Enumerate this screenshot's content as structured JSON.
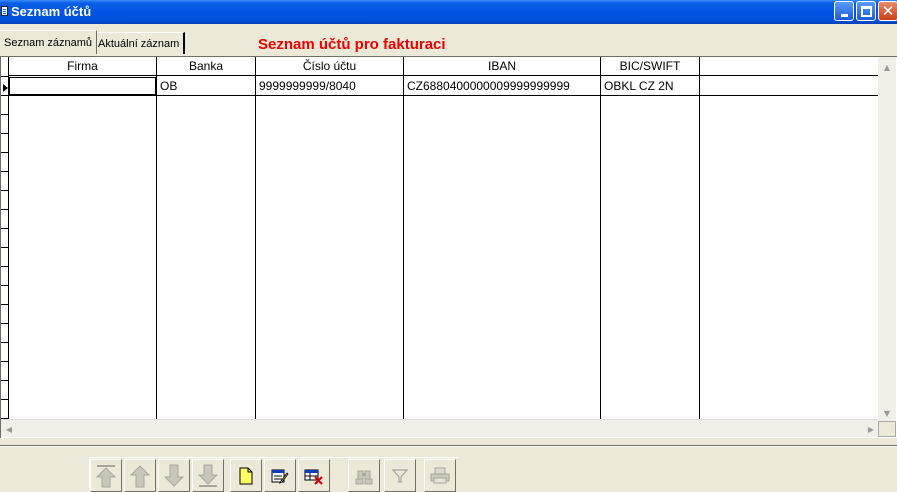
{
  "window": {
    "title": "Seznam účtů"
  },
  "tabs": [
    {
      "label": "Seznam záznamů",
      "active": true
    },
    {
      "label": "Aktuální záznam",
      "active": false
    }
  ],
  "heading": "Seznam účtů pro fakturaci",
  "colors": {
    "heading": "#ee0000",
    "titlebar": "#0054e3"
  },
  "grid": {
    "columns": [
      "Firma",
      "Banka",
      "Číslo účtu",
      "IBAN",
      "BIC/SWIFT"
    ],
    "rows": [
      [
        "",
        "OB",
        "9999999999/8040",
        "CZ6880400000009999999999",
        "OBKL CZ 2N"
      ]
    ]
  },
  "toolbar": {
    "buttons": [
      {
        "icon": "first-record-icon",
        "enabled": false
      },
      {
        "icon": "prior-record-icon",
        "enabled": false
      },
      {
        "icon": "next-record-icon",
        "enabled": false
      },
      {
        "icon": "last-record-icon",
        "enabled": false
      },
      {
        "icon": "new-record-icon",
        "enabled": true
      },
      {
        "icon": "edit-record-icon",
        "enabled": true
      },
      {
        "icon": "delete-record-icon",
        "enabled": true
      },
      {
        "icon": "search-record-icon",
        "enabled": false
      },
      {
        "icon": "filter-icon",
        "enabled": false
      },
      {
        "icon": "print-icon",
        "enabled": false
      }
    ]
  }
}
